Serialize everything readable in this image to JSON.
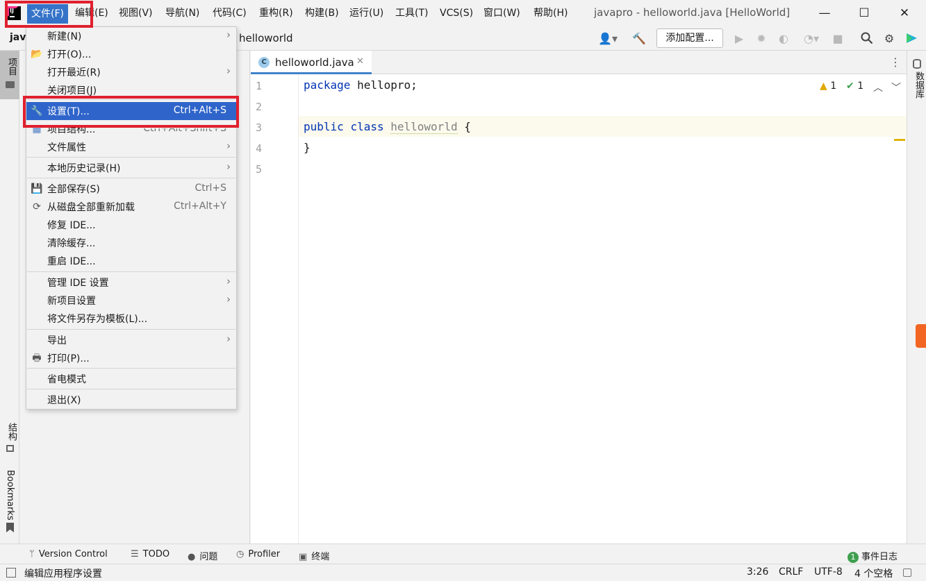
{
  "menubar": {
    "items": [
      {
        "label": "文件(F)",
        "active": true
      },
      {
        "label": "编辑(E)"
      },
      {
        "label": "视图(V)"
      },
      {
        "label": "导航(N)"
      },
      {
        "label": "代码(C)"
      },
      {
        "label": "重构(R)"
      },
      {
        "label": "构建(B)"
      },
      {
        "label": "运行(U)"
      },
      {
        "label": "工具(T)"
      },
      {
        "label": "VCS(S)"
      },
      {
        "label": "窗口(W)"
      },
      {
        "label": "帮助(H)"
      }
    ],
    "window_title": "javapro - helloworld.java [HelloWorld]",
    "minimize": "—",
    "maximize": "☐",
    "close": "✕"
  },
  "navbar": {
    "crumb_project": "jav",
    "crumb_file": "helloworld",
    "add_config": "添加配置..."
  },
  "file_menu": {
    "items": [
      {
        "label": "新建(N)",
        "submenu": true
      },
      {
        "label": "打开(O)...",
        "icon": "folder-open-icon"
      },
      {
        "label": "打开最近(R)",
        "submenu": true
      },
      {
        "label": "关闭项目(J)"
      },
      {
        "label": "设置(T)...",
        "shortcut": "Ctrl+Alt+S",
        "selected": true,
        "icon": "wrench-icon"
      },
      {
        "label": "项目结构...",
        "shortcut": "Ctrl+Alt+Shift+S",
        "icon": "project-structure-icon"
      },
      {
        "label": "文件属性",
        "submenu": true
      },
      {
        "label": "本地历史记录(H)",
        "submenu": true
      },
      {
        "label": "全部保存(S)",
        "shortcut": "Ctrl+S",
        "icon": "save-icon"
      },
      {
        "label": "从磁盘全部重新加载",
        "shortcut": "Ctrl+Alt+Y",
        "icon": "reload-icon"
      },
      {
        "label": "修复 IDE..."
      },
      {
        "label": "清除缓存..."
      },
      {
        "label": "重启 IDE..."
      },
      {
        "label": "管理 IDE 设置",
        "submenu": true
      },
      {
        "label": "新项目设置",
        "submenu": true
      },
      {
        "label": "将文件另存为模板(L)..."
      },
      {
        "label": "导出",
        "submenu": true
      },
      {
        "label": "打印(P)...",
        "icon": "print-icon"
      },
      {
        "label": "省电模式"
      },
      {
        "label": "退出(X)"
      }
    ]
  },
  "editor": {
    "tab_label": "helloworld.java",
    "tab_icon_letter": "C",
    "line_numbers": [
      "1",
      "2",
      "3",
      "4",
      "5"
    ],
    "code": {
      "l1_kw": "package",
      "l1_rest": " hellopro;",
      "l3_kw1": "public",
      "l3_kw2": "class",
      "l3_ident": "helloworld",
      "l3_rest": " {",
      "l4": "}"
    },
    "warnings": "1",
    "checks": "1"
  },
  "left_strip": {
    "project": "项目",
    "structure": "结构",
    "bookmarks": "Bookmarks"
  },
  "right_strip": {
    "database": "数据库"
  },
  "bottom_tools": {
    "version_control": "Version Control",
    "todo": "TODO",
    "problems": "问题",
    "profiler": "Profiler",
    "terminal": "终端",
    "event_log_count": "1",
    "event_log": "事件日志"
  },
  "status_bar": {
    "message": "编辑应用程序设置",
    "position": "3:26",
    "line_sep": "CRLF",
    "encoding": "UTF-8",
    "indent": "4 个空格"
  },
  "colors": {
    "accent": "#2f65ca",
    "highlight_box": "#e0202e",
    "keyword": "#0033b3"
  }
}
